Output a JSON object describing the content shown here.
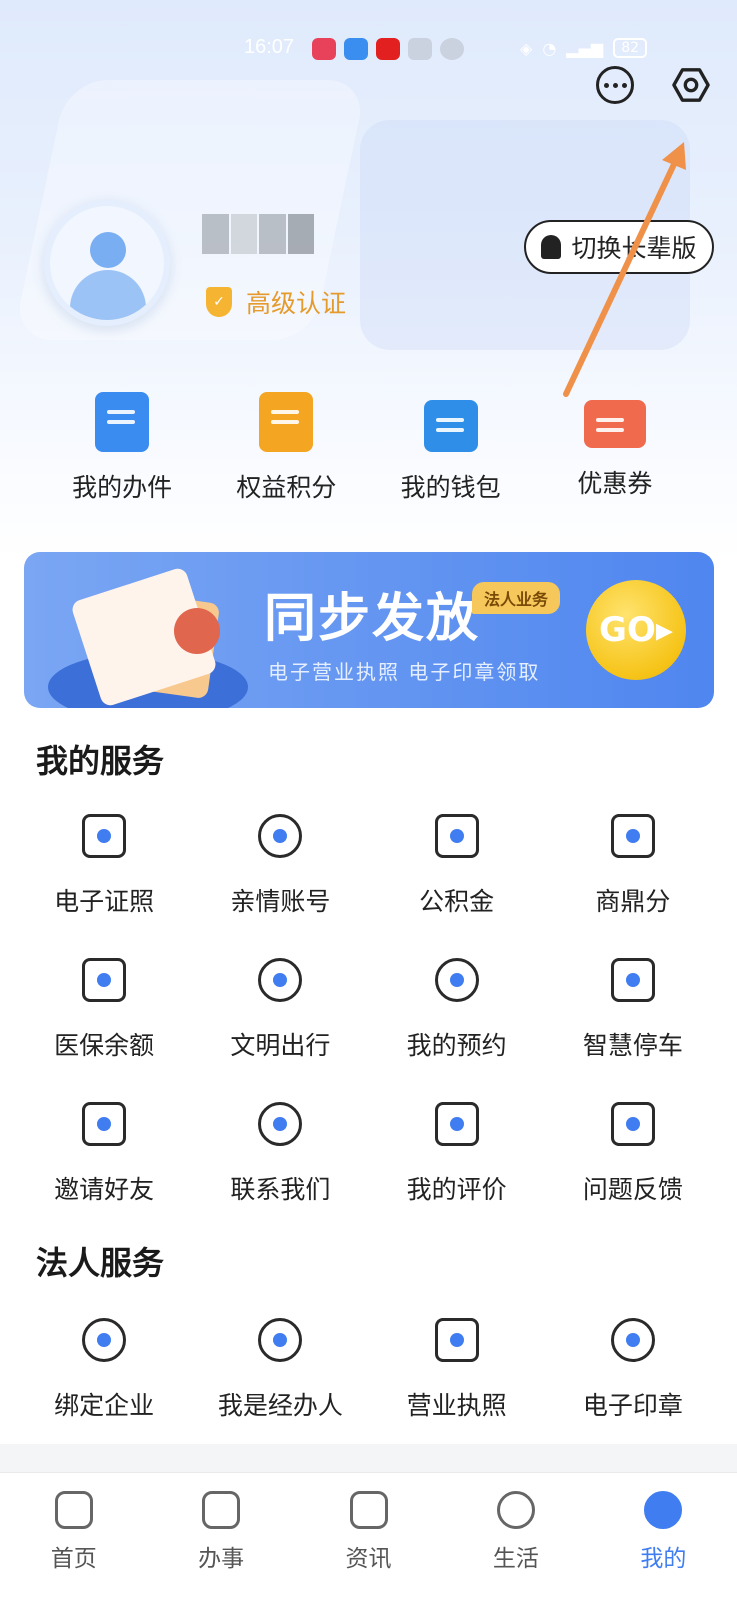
{
  "status_bar": {
    "time": "16:07",
    "battery": "82"
  },
  "header": {
    "more_icon": "more-dots-icon",
    "settings_icon": "settings-hexagon-icon"
  },
  "profile": {
    "auth_label": "高级认证",
    "elder_mode_button": "切换长辈版"
  },
  "quick_actions": [
    {
      "label": "我的办件",
      "icon": "clipboard-icon",
      "color": "#3a8cf0"
    },
    {
      "label": "权益积分",
      "icon": "scroll-icon",
      "color": "#f4a623"
    },
    {
      "label": "我的钱包",
      "icon": "wallet-icon",
      "color": "#2f8fe8"
    },
    {
      "label": "优惠券",
      "icon": "ticket-icon",
      "color": "#f06a4e"
    }
  ],
  "banner": {
    "title": "同步发放",
    "tag": "法人业务",
    "subtitle": "电子营业执照 电子印章领取",
    "go": "GO"
  },
  "my_services": {
    "title": "我的服务",
    "items": [
      {
        "label": "电子证照",
        "icon": "e-license-icon"
      },
      {
        "label": "亲情账号",
        "icon": "heart-handshake-icon"
      },
      {
        "label": "公积金",
        "icon": "house-fund-icon"
      },
      {
        "label": "商鼎分",
        "icon": "ding-icon"
      },
      {
        "label": "医保余额",
        "icon": "medical-card-icon"
      },
      {
        "label": "文明出行",
        "icon": "pedestrian-icon"
      },
      {
        "label": "我的预约",
        "icon": "alarm-clock-icon"
      },
      {
        "label": "智慧停车",
        "icon": "car-icon"
      },
      {
        "label": "邀请好友",
        "icon": "invite-mail-icon"
      },
      {
        "label": "联系我们",
        "icon": "phone-call-icon"
      },
      {
        "label": "我的评价",
        "icon": "comment-icon"
      },
      {
        "label": "问题反馈",
        "icon": "feedback-edit-icon"
      }
    ]
  },
  "legal_services": {
    "title": "法人服务",
    "items": [
      {
        "label": "绑定企业",
        "icon": "badge-check-icon"
      },
      {
        "label": "我是经办人",
        "icon": "agent-person-icon"
      },
      {
        "label": "营业执照",
        "icon": "business-license-icon"
      },
      {
        "label": "电子印章",
        "icon": "star-seal-icon"
      }
    ]
  },
  "tabbar": [
    {
      "label": "首页",
      "icon": "home-icon",
      "active": false
    },
    {
      "label": "办事",
      "icon": "clock-tasks-icon",
      "active": false
    },
    {
      "label": "资讯",
      "icon": "news-icon",
      "active": false
    },
    {
      "label": "生活",
      "icon": "heart-life-icon",
      "active": false
    },
    {
      "label": "我的",
      "icon": "user-profile-icon",
      "active": true
    }
  ],
  "colors": {
    "accent": "#3f7df0",
    "auth_gold": "#e59a2c",
    "annotation_arrow": "#f0914a"
  }
}
